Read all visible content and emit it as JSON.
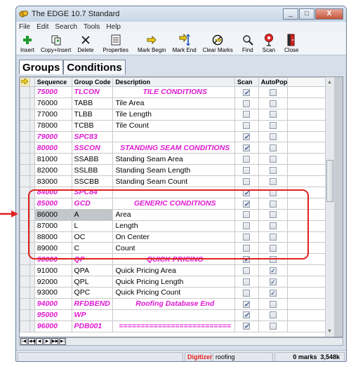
{
  "window": {
    "title": "The EDGE 10.7 Standard",
    "controls": [
      "_",
      "□",
      "X"
    ]
  },
  "menu": [
    "File",
    "Edit",
    "Search",
    "Tools",
    "Help"
  ],
  "toolbar": [
    {
      "label": "Insert",
      "icon": "plus-icon"
    },
    {
      "label": "Copy+Insert",
      "icon": "copy-icon"
    },
    {
      "label": "Delete",
      "icon": "delete-x-icon"
    },
    {
      "label": "Properties",
      "icon": "properties-icon"
    },
    {
      "label": "Mark Begin",
      "icon": "arrow-right-icon"
    },
    {
      "label": "Mark End",
      "icon": "mark-end-icon"
    },
    {
      "label": "Clear Marks",
      "icon": "no-entry-icon"
    },
    {
      "label": "Find",
      "icon": "magnifier-icon"
    },
    {
      "label": "Scan",
      "icon": "scan-icon"
    },
    {
      "label": "Close",
      "icon": "close-door-icon"
    }
  ],
  "tabs": [
    "Groups",
    "Conditions"
  ],
  "columns": [
    "Sequence",
    "Group Code",
    "Description",
    "Scan",
    "AutoPop"
  ],
  "rows": [
    {
      "seq": "75000",
      "code": "TLCON",
      "desc": "TILE CONDITIONS",
      "scan": true,
      "autopop": false,
      "header": true
    },
    {
      "seq": "76000",
      "code": "TABB",
      "desc": "Tile Area",
      "scan": false,
      "autopop": false
    },
    {
      "seq": "77000",
      "code": "TLBB",
      "desc": "Tile Length",
      "scan": false,
      "autopop": false
    },
    {
      "seq": "78000",
      "code": "TCBB",
      "desc": "Tile Count",
      "scan": false,
      "autopop": false
    },
    {
      "seq": "79000",
      "code": "SPC83",
      "desc": "",
      "scan": true,
      "autopop": false,
      "header": true
    },
    {
      "seq": "80000",
      "code": "SSCON",
      "desc": "STANDING SEAM CONDITIONS",
      "scan": true,
      "autopop": false,
      "header": true
    },
    {
      "seq": "81000",
      "code": "SSABB",
      "desc": "Standing Seam Area",
      "scan": false,
      "autopop": false
    },
    {
      "seq": "82000",
      "code": "SSLBB",
      "desc": "Standing Seam Length",
      "scan": false,
      "autopop": false
    },
    {
      "seq": "83000",
      "code": "SSCBB",
      "desc": "Standing Seam Count",
      "scan": false,
      "autopop": false
    },
    {
      "seq": "84000",
      "code": "SPC84",
      "desc": "",
      "scan": true,
      "autopop": false,
      "header": true
    },
    {
      "seq": "85000",
      "code": "GCD",
      "desc": "GENERIC CONDITIONS",
      "scan": true,
      "autopop": false,
      "header": true
    },
    {
      "seq": "86000",
      "code": "A",
      "desc": "Area",
      "scan": false,
      "autopop": false,
      "selected": true
    },
    {
      "seq": "87000",
      "code": "L",
      "desc": "Length",
      "scan": false,
      "autopop": false
    },
    {
      "seq": "88000",
      "code": "OC",
      "desc": "On Center",
      "scan": false,
      "autopop": false
    },
    {
      "seq": "89000",
      "code": "C",
      "desc": "Count",
      "scan": false,
      "autopop": false
    },
    {
      "seq": "90000",
      "code": "QP",
      "desc": "QUICK PRICING",
      "scan": true,
      "autopop": false,
      "header": true
    },
    {
      "seq": "91000",
      "code": "QPA",
      "desc": "Quick Pricing Area",
      "scan": false,
      "autopop": true
    },
    {
      "seq": "92000",
      "code": "QPL",
      "desc": "Quick Pricing Length",
      "scan": false,
      "autopop": true
    },
    {
      "seq": "93000",
      "code": "QPC",
      "desc": "Quick Pricing Count",
      "scan": false,
      "autopop": true
    },
    {
      "seq": "94000",
      "code": "RFDBEND",
      "desc": "Roofing Database End",
      "scan": true,
      "autopop": false,
      "header": true
    },
    {
      "seq": "95000",
      "code": "WP",
      "desc": "",
      "scan": true,
      "autopop": false,
      "header": true
    },
    {
      "seq": "96000",
      "code": "PDB001",
      "desc": "==========================",
      "scan": true,
      "autopop": false,
      "header": true
    }
  ],
  "status": {
    "mode": "Digitizer",
    "db": "roofing",
    "marks": "0 marks",
    "size": "3,548k"
  },
  "colors": {
    "header_text": "#e01ad3",
    "annotation": "#e02020",
    "check": "#1b3d7a"
  }
}
